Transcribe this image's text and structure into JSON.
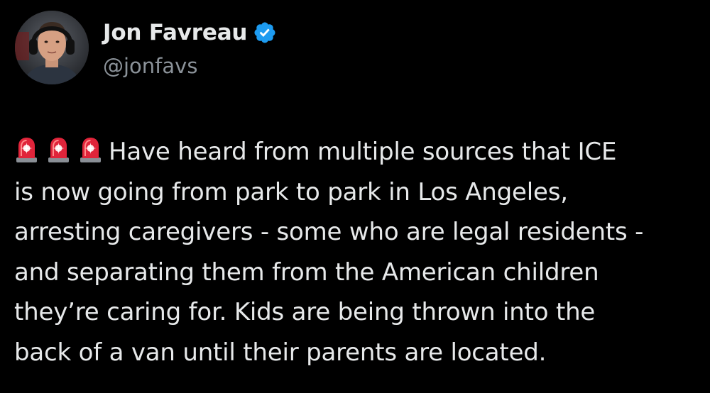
{
  "user": {
    "display_name": "Jon Favreau",
    "handle": "@jonfavs",
    "verified_icon": "verified-badge-icon",
    "avatar_icon": "avatar"
  },
  "tweet": {
    "leading_icons": [
      "police-siren-icon",
      "police-siren-icon",
      "police-siren-icon"
    ],
    "lines": [
      "Have heard from multiple sources that ICE",
      "is now going from park to park in Los Angeles,",
      "arresting caregivers - some who are legal residents -",
      "and separating them from the American children",
      "they’re caring for. Kids are being thrown into the",
      "back of a van until their parents are located."
    ]
  },
  "colors": {
    "background": "#000000",
    "text": "#e7e9ea",
    "secondary_text": "#8b9299",
    "verified_blue": "#1d9bf0",
    "siren_red": "#e0243a"
  }
}
